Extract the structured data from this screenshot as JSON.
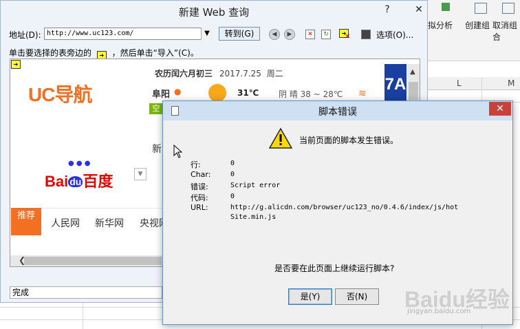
{
  "excel": {
    "ribbon": {
      "item1": "拟分析",
      "item2": "创建组",
      "item3": "取消组合"
    },
    "columns": [
      "L",
      "M"
    ]
  },
  "web_query": {
    "title": "新建 Web 查询",
    "help": "?",
    "minimize": "—",
    "close": "✕",
    "address_label": "地址(D):",
    "address_value": "http://www.uc123.com/",
    "goto_label": "转到(G)",
    "options_label": "选项(O)...",
    "hint_prefix": "单击要选择的表旁边的",
    "hint_suffix": "，然后单击“导入”(C)。",
    "status": "完成"
  },
  "web_page": {
    "logo": "UC导航",
    "lunar_date": "农历闰六月初三",
    "date": "2017.7.25",
    "weekday": "周二",
    "city": "阜阳",
    "temperature": "31℃",
    "weather": "阴 晴 38 ~ 28℃",
    "air_quality": "空",
    "search_fragment": "新",
    "baidu_logo_bai": "Bai",
    "baidu_logo_du": "du",
    "baidu_logo_cn": "百度",
    "recommend": "推荐",
    "nav_links": [
      "人民网",
      "新华网",
      "央视网"
    ],
    "side_banner": "7A"
  },
  "dialog": {
    "title": "脚本错误",
    "close": "✕",
    "message": "当前页面的脚本发生错误。",
    "fields": [
      {
        "key": "行:",
        "value": "0"
      },
      {
        "key": "Char:",
        "value": "0"
      },
      {
        "key": "错误:",
        "value": "Script error"
      },
      {
        "key": "代码:",
        "value": "0"
      },
      {
        "key": "URL:",
        "value": "http://g.alicdn.com/browser/uc123_no/0.4.6/index/js/hot"
      },
      {
        "key": "",
        "value": "Site.min.js"
      }
    ],
    "question": "是否要在此页面上继续运行脚本?",
    "yes": "是(Y)",
    "no": "否(N)"
  },
  "watermark": {
    "main": "Baidu经验",
    "sub": "jingyan.baidu.com"
  },
  "colors": {
    "uc_orange": "#f36f21",
    "dialog_close": "#c9413a",
    "baidu_red": "#e10601",
    "baidu_blue": "#2932e1"
  }
}
